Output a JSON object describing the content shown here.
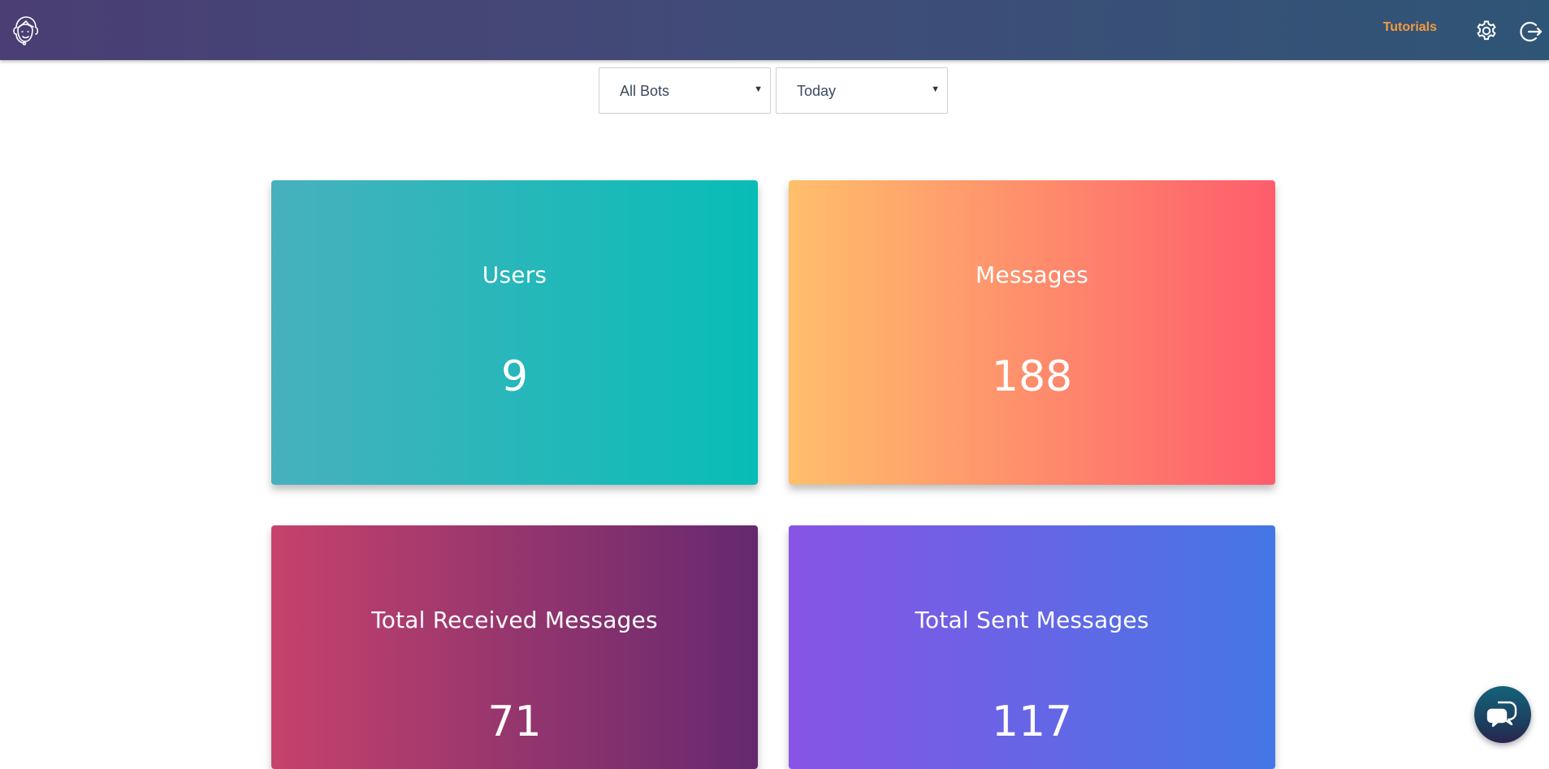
{
  "header": {
    "logo_icon": "support-agent-icon",
    "tutorials_label": "Tutorials",
    "settings_icon": "gear-icon",
    "logout_icon": "logout-icon",
    "tutorials_color": "#f59a3e"
  },
  "filters": {
    "bot": {
      "selected": "All Bots"
    },
    "range": {
      "selected": "Today"
    }
  },
  "cards": [
    {
      "label": "Users",
      "value": "9",
      "gradient": [
        "#47b1bd",
        "#08bdb6"
      ]
    },
    {
      "label": "Messages",
      "value": "188",
      "gradient": [
        "#ffbf6c",
        "#fe5c6c"
      ]
    },
    {
      "label": "Total Received Messages",
      "value": "71",
      "gradient": [
        "#c6426c",
        "#65296f"
      ]
    },
    {
      "label": "Total Sent Messages",
      "value": "117",
      "gradient": [
        "#8854e6",
        "#4476e6"
      ]
    }
  ],
  "chat_widget": {
    "icon": "chat-bubbles-icon"
  }
}
